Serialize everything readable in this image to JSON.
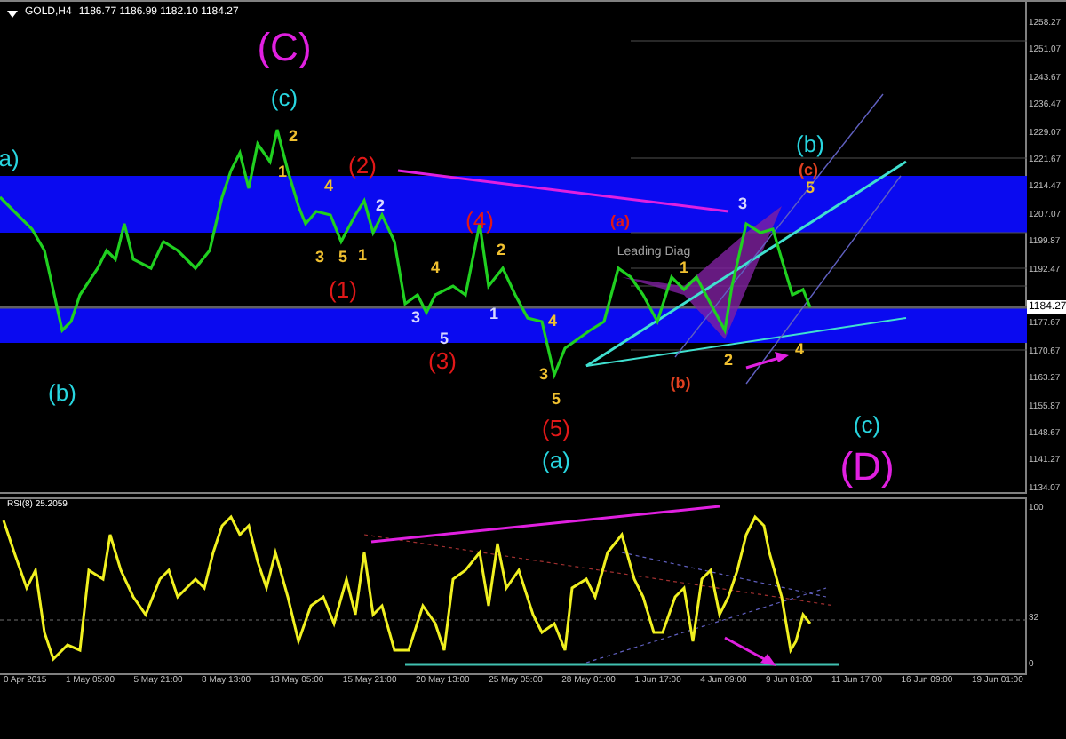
{
  "header": {
    "symbol": "GOLD,H4",
    "quote": "1186.77 1186.99 1182.10 1184.27"
  },
  "price_axis": {
    "labels": [
      "1258.27",
      "1251.07",
      "1243.67",
      "1236.47",
      "1229.07",
      "1221.67",
      "1214.47",
      "1207.07",
      "1199.87",
      "1192.47",
      "1177.67",
      "1170.67",
      "1163.27",
      "1155.87",
      "1148.67",
      "1141.27",
      "1134.07"
    ],
    "current": "1184.27"
  },
  "wave_labels": [
    {
      "text": "(C)",
      "color": "#e020e0",
      "kind": "major"
    },
    {
      "text": "(c)",
      "color": "#28d6e0",
      "kind": "medium"
    },
    {
      "text": "a)",
      "color": "#28d6e0",
      "kind": "medium"
    },
    {
      "text": "(b)",
      "color": "#28d6e0",
      "kind": "medium"
    },
    {
      "text": "(2)",
      "color": "#e01818",
      "kind": "medium"
    },
    {
      "text": "(4)",
      "color": "#e01818",
      "kind": "medium"
    },
    {
      "text": "(1)",
      "color": "#e01818",
      "kind": "medium"
    },
    {
      "text": "(3)",
      "color": "#e01818",
      "kind": "medium"
    },
    {
      "text": "(5)",
      "color": "#e01818",
      "kind": "medium"
    },
    {
      "text": "(a)",
      "color": "#28d6e0",
      "kind": "medium"
    },
    {
      "text": "(b)",
      "color": "#28d6e0",
      "kind": "medium"
    },
    {
      "text": "(c)",
      "color": "#e04020",
      "kind": "minor"
    },
    {
      "text": "5",
      "color": "#f0c030",
      "kind": "minor"
    },
    {
      "text": "3",
      "color": "#d8d8ff",
      "kind": "minor"
    },
    {
      "text": "(a)",
      "color": "#e01818",
      "kind": "minor"
    },
    {
      "text": "(b)",
      "color": "#e04020",
      "kind": "minor"
    },
    {
      "text": "2",
      "color": "#f0c030",
      "kind": "minor"
    },
    {
      "text": "4",
      "color": "#f0c030",
      "kind": "minor"
    },
    {
      "text": "(c)",
      "color": "#28d6e0",
      "kind": "medium"
    },
    {
      "text": "(D)",
      "color": "#e020e0",
      "kind": "major"
    },
    {
      "text": "Leading Diag",
      "color": "#a0a0a0",
      "kind": "note"
    },
    {
      "text": "2",
      "color": "#f0c030",
      "kind": "minor"
    },
    {
      "text": "1",
      "color": "#f0c030",
      "kind": "minor"
    },
    {
      "text": "4",
      "color": "#f0c030",
      "kind": "minor"
    },
    {
      "text": "3",
      "color": "#f0c030",
      "kind": "minor"
    },
    {
      "text": "5",
      "color": "#f0c030",
      "kind": "minor"
    },
    {
      "text": "1",
      "color": "#f0c030",
      "kind": "minor"
    },
    {
      "text": "2",
      "color": "#d8d8ff",
      "kind": "minor"
    },
    {
      "text": "4",
      "color": "#f0c030",
      "kind": "minor"
    },
    {
      "text": "3",
      "color": "#d8d8ff",
      "kind": "minor"
    },
    {
      "text": "5",
      "color": "#d8d8ff",
      "kind": "minor"
    },
    {
      "text": "2",
      "color": "#f0c030",
      "kind": "minor"
    },
    {
      "text": "1",
      "color": "#d8d8ff",
      "kind": "minor"
    },
    {
      "text": "4",
      "color": "#f0c030",
      "kind": "minor"
    },
    {
      "text": "3",
      "color": "#f0c030",
      "kind": "minor"
    },
    {
      "text": "5",
      "color": "#f0c030",
      "kind": "minor"
    },
    {
      "text": "1",
      "color": "#f0c030",
      "kind": "minor"
    }
  ],
  "rsi": {
    "title": "RSI(8) 25.2059",
    "axis_labels": [
      "100",
      "32",
      "0"
    ]
  },
  "time_axis": [
    "0 Apr 2015",
    "1 May 05:00",
    "5 May 21:00",
    "8 May 13:00",
    "13 May 05:00",
    "15 May 21:00",
    "20 May 13:00",
    "25 May 05:00",
    "28 May 01:00",
    "1 Jun 17:00",
    "4 Jun 09:00",
    "9 Jun 01:00",
    "11 Jun 17:00",
    "16 Jun 09:00",
    "19 Jun 01:00"
  ]
}
